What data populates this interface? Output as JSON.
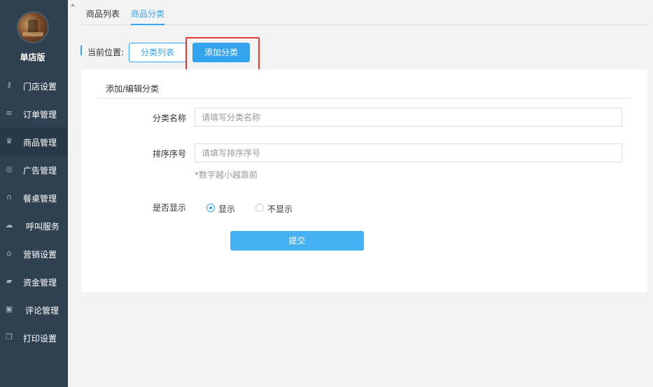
{
  "sidebar": {
    "shop_name": "单店版",
    "items": [
      {
        "label": "门店设置",
        "icon": "key-icon",
        "glyph": "⚷"
      },
      {
        "label": "订单管理",
        "icon": "list-icon",
        "glyph": "≡"
      },
      {
        "label": "商品管理",
        "icon": "trophy-icon",
        "glyph": "♛"
      },
      {
        "label": "广告管理",
        "icon": "lifebuoy-icon",
        "glyph": "◎"
      },
      {
        "label": "餐桌管理",
        "icon": "binoculars-icon",
        "glyph": "∩"
      },
      {
        "label": "呼叫服务",
        "icon": "cloud-icon",
        "glyph": "☁"
      },
      {
        "label": "营销设置",
        "icon": "gift-icon",
        "glyph": "⌂"
      },
      {
        "label": "资金管理",
        "icon": "book-icon",
        "glyph": "▰"
      },
      {
        "label": "评论管理",
        "icon": "money-icon",
        "glyph": "▣"
      },
      {
        "label": "打印设置",
        "icon": "copy-icon",
        "glyph": "❐"
      }
    ],
    "active_index": 2
  },
  "tabs": [
    {
      "label": "商品列表"
    },
    {
      "label": "商品分类"
    }
  ],
  "breadcrumb": {
    "label": "当前位置:",
    "category_list_button": "分类列表",
    "add_category_button": "添加分类"
  },
  "form": {
    "title": "添加/编辑分类",
    "name_label": "分类名称",
    "name_placeholder": "请填写分类名称",
    "name_value": "",
    "sort_label": "排序序号",
    "sort_placeholder": "请填写排序序号",
    "sort_value": "",
    "sort_hint": "*数字越小越靠前",
    "display_label": "是否显示",
    "display_options": [
      "显示",
      "不显示"
    ],
    "display_selected": "显示",
    "submit_label": "提交"
  },
  "colors": {
    "sidebar_bg": "#2f4050",
    "accent": "#35a4ef",
    "highlight": "#e53935"
  }
}
